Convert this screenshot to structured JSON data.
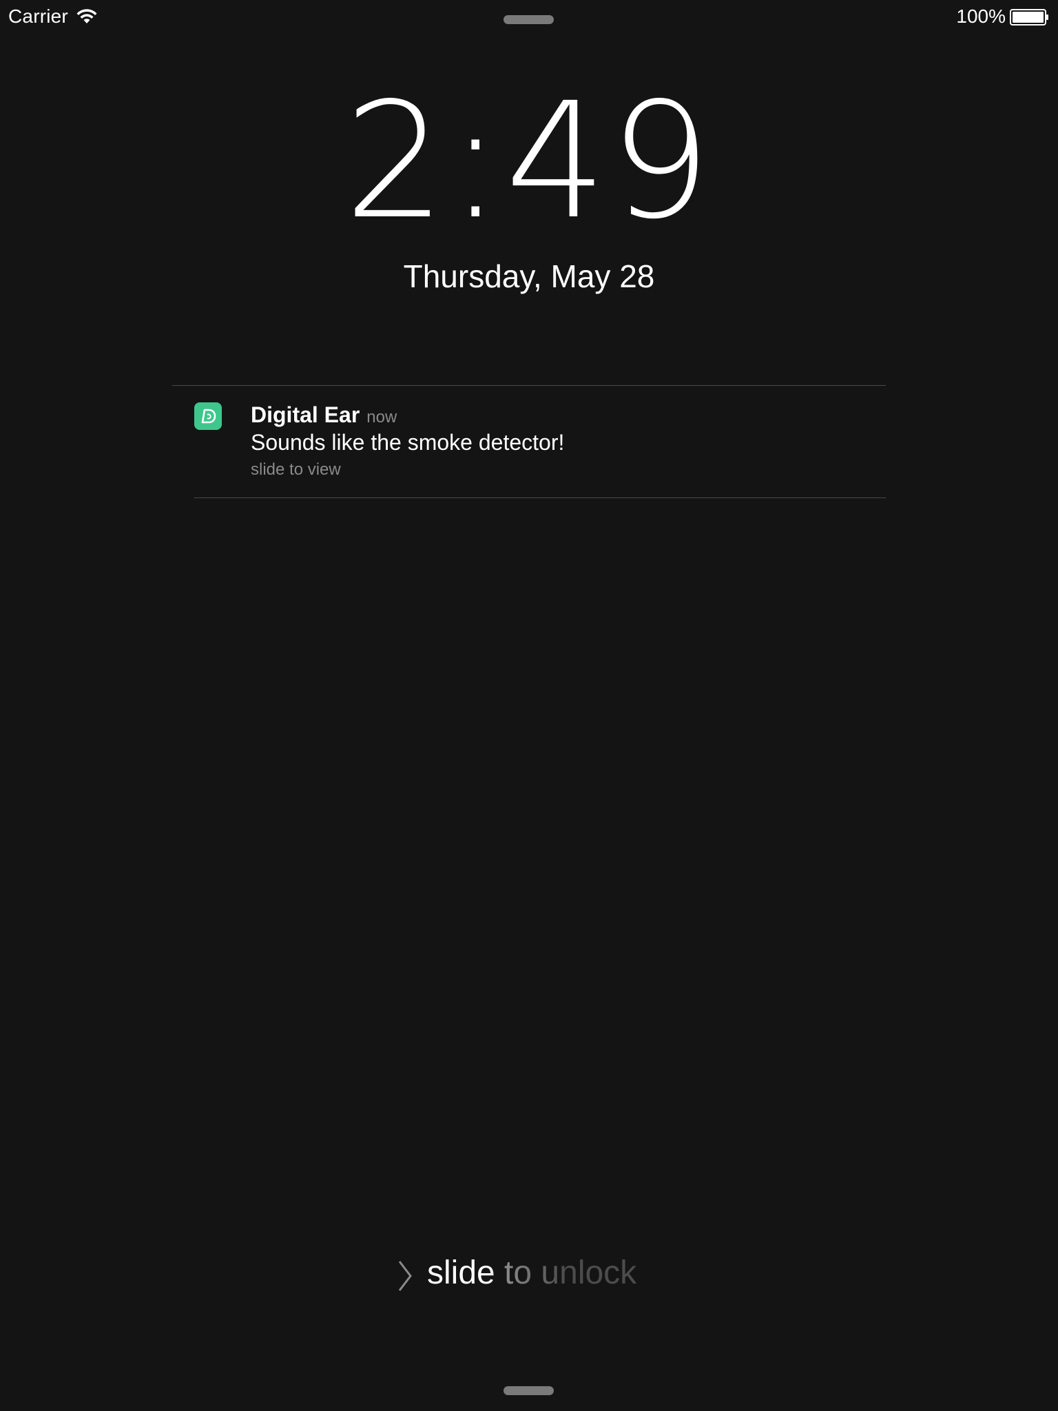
{
  "status_bar": {
    "carrier": "Carrier",
    "battery_percent": "100%",
    "wifi_icon": "wifi-icon",
    "battery_icon": "battery-icon",
    "battery_level": 1.0
  },
  "lock_screen": {
    "time": "2:49",
    "date": "Thursday, May 28"
  },
  "notification": {
    "app_name": "Digital Ear",
    "time": "now",
    "message": "Sounds like the smoke detector!",
    "action": "slide to view",
    "icon": "digital-ear-app-icon",
    "icon_color": "#3ec78c"
  },
  "unlock": {
    "label": "slide to unlock",
    "chevron_icon": "chevron-right-icon"
  },
  "colors": {
    "background": "#141414",
    "text": "#ffffff",
    "secondary_text": "#8a8a8a"
  }
}
